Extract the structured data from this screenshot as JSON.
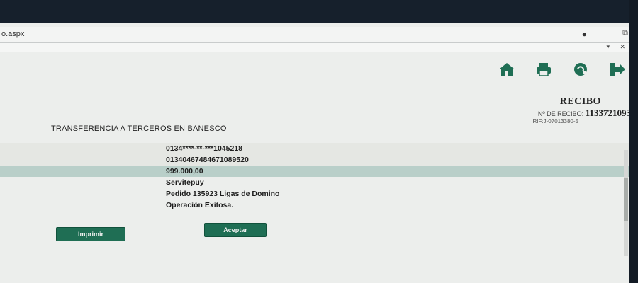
{
  "browser": {
    "address": "o.aspx",
    "user_glyph": "●",
    "minimize_glyph": "—",
    "restore_glyph": "⧉",
    "sub_icons": "▾ ✕"
  },
  "toolbar": {
    "icons": [
      "home-icon",
      "print-icon",
      "contact-icon",
      "exit-icon"
    ],
    "accent": "#1f6e54"
  },
  "receipt": {
    "title": "RECIBO",
    "number_label": "Nº DE RECIBO:",
    "number": "1133721093",
    "rif": "RIF:J-07013380-5"
  },
  "page_title": "TRANSFERENCIA A TERCEROS EN BANESCO",
  "details": [
    {
      "value": "0134****-**-***1045218"
    },
    {
      "value": "01340467484671089520"
    },
    {
      "value": "999.000,00"
    },
    {
      "value": "Servitepuy"
    },
    {
      "value": "Pedido 135923 Ligas de Domino"
    },
    {
      "value": "Operación Exitosa."
    }
  ],
  "buttons": {
    "print_label": "Imprimir",
    "accept_label": "Aceptar"
  }
}
